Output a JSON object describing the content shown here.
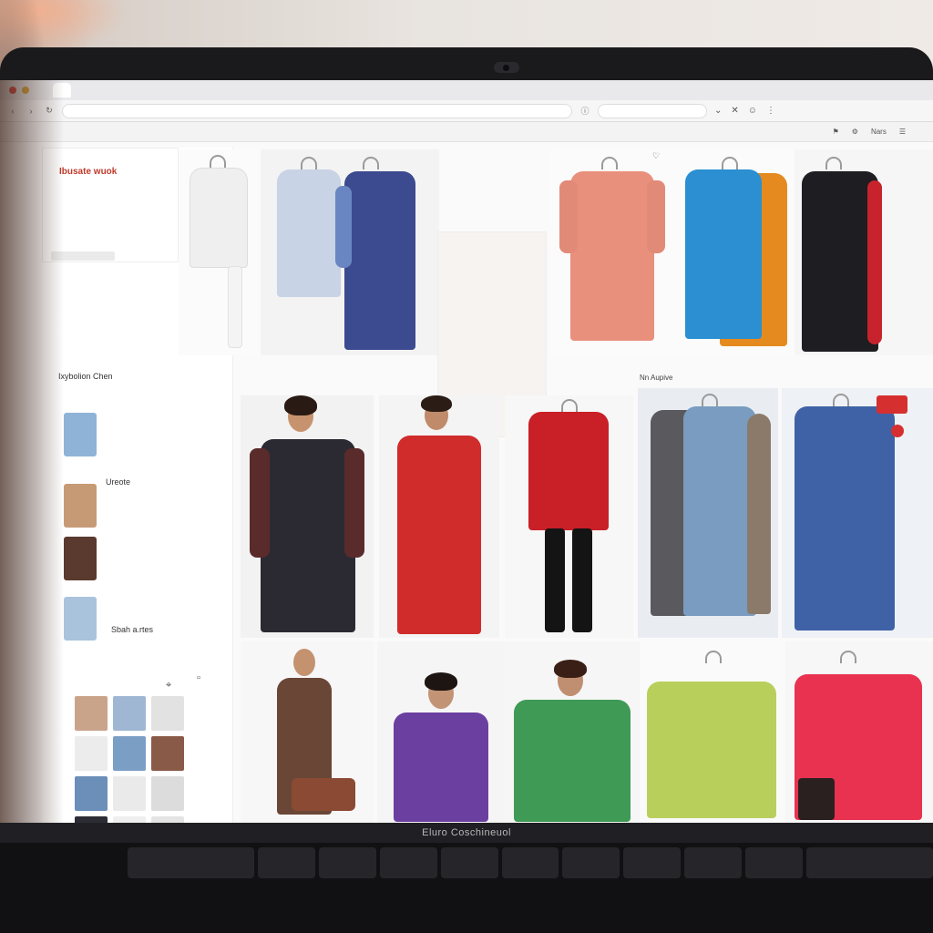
{
  "browser": {
    "tab_title": "",
    "url": "",
    "search": "",
    "bookmarks": [
      "",
      "",
      "",
      "Nars"
    ]
  },
  "sidebar": {
    "title": "",
    "promo_red": "Ibusate wuok",
    "line1": "",
    "line2": "",
    "filter_label": "",
    "section_head": "Ixybolion Chen",
    "section_sub": "",
    "items": [
      {
        "label": "",
        "color": "#8eb3d6"
      },
      {
        "label": "Ureote",
        "color": "#e9e9e9"
      },
      {
        "label": "",
        "color": "#c79a76",
        "red": true
      },
      {
        "label": "",
        "color": "#e6e6e6"
      },
      {
        "label": "",
        "color": "#5a3a2e"
      },
      {
        "label": "",
        "color": "#eeeeee"
      },
      {
        "label": "",
        "color": "#a9c3dc"
      },
      {
        "label": "Sbah a.rtes",
        "color": "#d9d9d9"
      }
    ],
    "muted": [
      "",
      "",
      ""
    ]
  },
  "promo": {
    "line1": "",
    "line2": "",
    "line3": "",
    "line4": ""
  },
  "products": {
    "row2_meta": [
      "",
      "",
      "",
      "Nn Aupive",
      ""
    ],
    "badge": "",
    "colors": {
      "white_blouse": "#efefef",
      "floral_blue": "#a7b7d6",
      "indigo_print": "#3c4b8f",
      "coral_shirt": "#e9907c",
      "blue_tee": "#2b8fd1",
      "orange_tee": "#e58a1e",
      "black_dress": "#1d1d22",
      "red_scarf": "#c8232c",
      "black_floral": "#2b2a33",
      "red_floral": "#d12c2c",
      "red_top": "#c91f27",
      "denim_patch": "#7a9cc0",
      "blue_print": "#3f62a6",
      "brown_dress": "#6a4636",
      "purple_top": "#6b3fa0",
      "green_print": "#3f9a55",
      "lime_top": "#b9cf5c",
      "pink_top": "#e83250"
    }
  },
  "laptop": {
    "label": "Eluro Coschineuol"
  }
}
